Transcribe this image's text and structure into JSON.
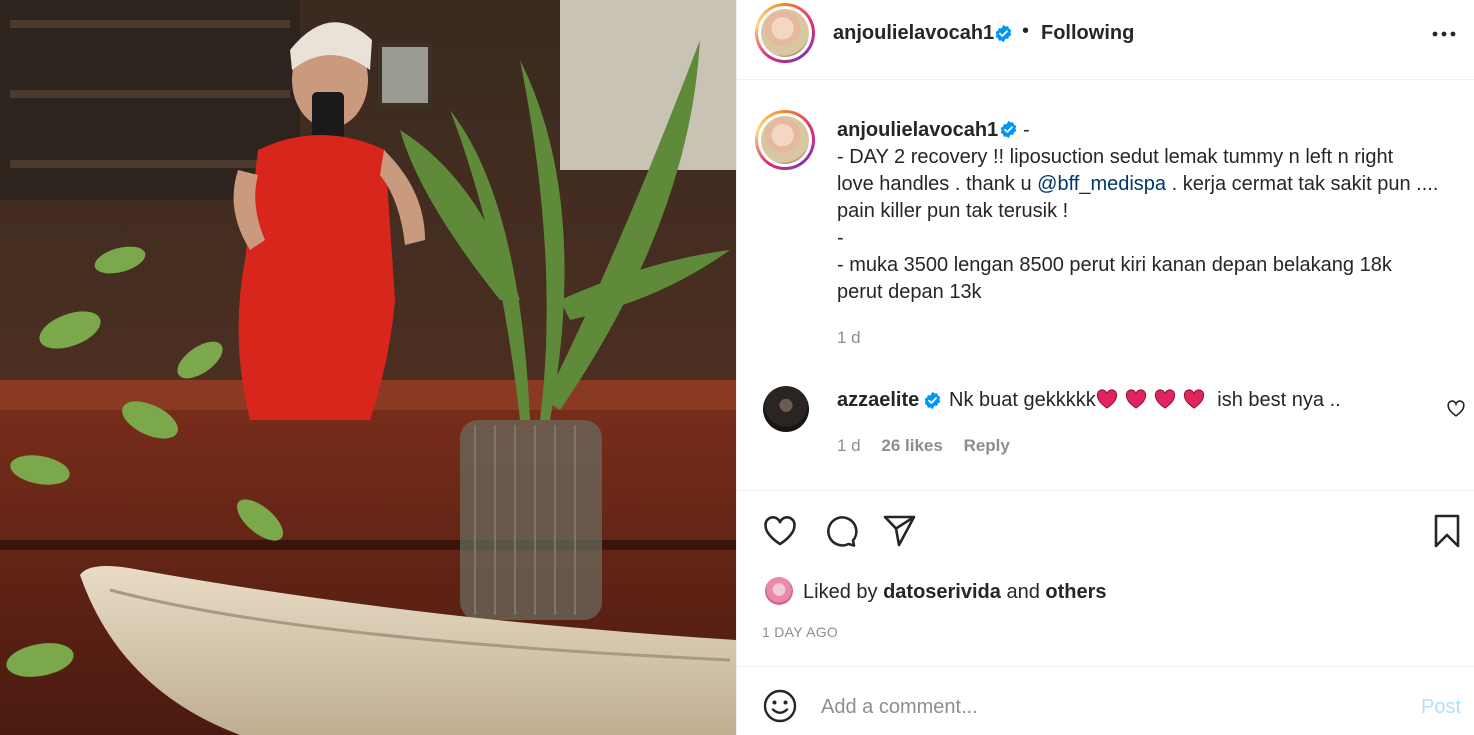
{
  "header": {
    "username": "anjoulielavocah1",
    "separator": "•",
    "follow_status": "Following",
    "more_icon": "more-horizontal-icon"
  },
  "caption": {
    "username": "anjoulielavocah1",
    "dash": "-",
    "text_part1": "- DAY 2 recovery !! liposuction sedut lemak tummy n left n right\nlove handles . thank u ",
    "mention": "@bff_medispa",
    "text_part2": " . kerja cermat tak sakit pun ....\npain killer pun tak terusik !\n-\n- muka 3500 lengan 8500 perut kiri kanan depan belakang 18k\nperut depan 13k",
    "time": "1 d"
  },
  "comment": {
    "username": "azzaelite",
    "text_before": "Nk buat gekkkkk",
    "text_after": " ish best nya ..",
    "heart_count": 4,
    "time": "1 d",
    "likes": "26 likes",
    "reply": "Reply"
  },
  "actions": {
    "like_icon": "heart-icon",
    "comment_icon": "comment-icon",
    "share_icon": "share-icon",
    "save_icon": "bookmark-icon"
  },
  "likes": {
    "prefix": "Liked by ",
    "user": "datoserivida",
    "middle": " and ",
    "others": "others"
  },
  "date": "1 DAY AGO",
  "add_comment": {
    "placeholder": "Add a comment...",
    "post_label": "Post"
  },
  "colors": {
    "verified": "#0095f6",
    "mention": "#00376b",
    "muted": "#8e8e8e",
    "post_disabled": "#b2dffc",
    "heart_red": "#e0245e"
  }
}
